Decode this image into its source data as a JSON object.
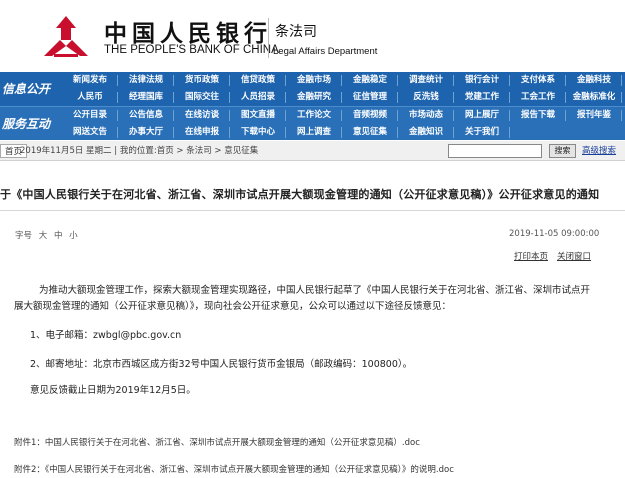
{
  "header": {
    "bank_name_cn": "中国人民银行",
    "bank_name_en": "THE PEOPLE'S BANK OF CHINA",
    "dept_cn": "条法司",
    "dept_en": "Legal Affairs Department"
  },
  "nav": {
    "section1_label": "信息公开",
    "section2_label": "服务互动",
    "section1_rows": [
      [
        "新闻发布",
        "法律法规",
        "货币政策",
        "信贷政策",
        "金融市场",
        "金融稳定",
        "调查统计",
        "银行会计",
        "支付体系",
        "金融科技"
      ],
      [
        "人民币",
        "经理国库",
        "国际交往",
        "人员招录",
        "金融研究",
        "征信管理",
        "反洗钱",
        "党建工作",
        "工会工作",
        "金融标准化"
      ]
    ],
    "section2_rows": [
      [
        "公开目录",
        "公告信息",
        "在线访谈",
        "图文直播",
        "工作论文",
        "音频视频",
        "市场动态",
        "网上展厅",
        "报告下载",
        "报刊年鉴"
      ],
      [
        "网送文告",
        "办事大厅",
        "在线申报",
        "下载中心",
        "网上调查",
        "意见征集",
        "金融知识",
        "关于我们"
      ]
    ]
  },
  "crumbs": {
    "home_label": "首页",
    "path": "2019年11月5日 星期二 | 我的位置:首页 > 条法司 > 意见征集",
    "search_placeholder": "",
    "search_btn": "搜索",
    "advanced_search": "高级搜索"
  },
  "article": {
    "title": "于《中国人民银行关于在河北省、浙江省、深圳市试点开展大额现金管理的通知（公开征求意见稿）》公开征求意见的通知",
    "font_size_label": "字号",
    "font_sizes": [
      "大",
      "中",
      "小"
    ],
    "date": "2019-11-05 09:00:00",
    "print_link": "打印本页",
    "close_link": "关闭窗口",
    "para1a": "为推动大额现金管理工作，探索大额现金管理实现路径，中国人民银行起草了《中国人民银行关于在河北省、浙江省、深圳市试点开",
    "para1b": "展大额现金管理的通知（公开征求意见稿）》，现向社会公开征求意见，公众可以通过以下途径反馈意见：",
    "item1": "1、电子邮箱：zwbgl@pbc.gov.cn",
    "item2": "2、邮寄地址：北京市西城区成方街32号中国人民银行货币金银局（邮政编码：100800）。",
    "deadline": "意见反馈截止日期为2019年12月5日。",
    "attachment1": "附件1：中国人民银行关于在河北省、浙江省、深圳市试点开展大额现金管理的通知（公开征求意见稿）.doc",
    "attachment2": "附件2：《中国人民银行关于在河北省、浙江省、深圳市试点开展大额现金管理的通知（公开征求意见稿）》的说明.doc"
  },
  "colors": {
    "nav_blue": "#1d63ad",
    "logo_red": "#c8102e",
    "link_blue": "#1a3f9b"
  }
}
